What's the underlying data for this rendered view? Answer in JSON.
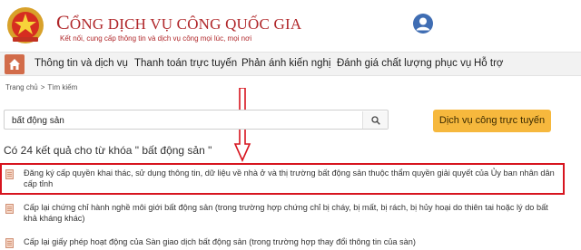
{
  "header": {
    "title_initial": "C",
    "title_rest": "ỔNG DỊCH VỤ CÔNG QUỐC GIA",
    "subtitle": "Kết nối, cung cấp thông tin và dịch vụ công mọi lúc, mọi nơi",
    "emblem_icon": "national-emblem-icon",
    "user_icon": "user-account-icon"
  },
  "nav": {
    "home_icon": "home-icon",
    "items": [
      {
        "label": "Thông tin và dịch vụ"
      },
      {
        "label": "Thanh toán trực tuyến"
      },
      {
        "label": "Phản ánh kiến nghị"
      },
      {
        "label": "Đánh giá chất lượng phục vụ"
      },
      {
        "label": "Hỗ trợ"
      }
    ]
  },
  "breadcrumb": {
    "home": "Trang chủ",
    "separator": ">",
    "current": "Tìm kiếm"
  },
  "search": {
    "value": "bất động sản",
    "button_icon": "search-icon"
  },
  "service_button": {
    "label": "Dịch vụ công trực tuyến"
  },
  "results": {
    "heading": "Có 24 kết quả cho từ khóa \" bất động sản \"",
    "items": [
      {
        "text": "Đăng ký cấp quyền khai thác, sử dụng thông tin, dữ liệu về nhà ở và thị trường bất động sản thuộc thẩm quyền giải quyết của Ủy ban nhân dân cấp tỉnh"
      },
      {
        "text": "Cấp lại chứng chỉ hành nghề môi giới bất động sản (trong trường hợp chứng chỉ bị cháy, bị mất, bị rách, bị hủy hoại do thiên tai hoặc lý do bất khả kháng khác)"
      },
      {
        "text": "Cấp lại giấy phép hoạt động của Sàn giao dịch bất động sản (trong trường hợp thay đổi thông tin của sàn)"
      }
    ]
  },
  "colors": {
    "brand_red": "#b0272a",
    "home_button": "#d26c4a",
    "service_button": "#f6b83d",
    "annotation_red": "#d7151f"
  }
}
